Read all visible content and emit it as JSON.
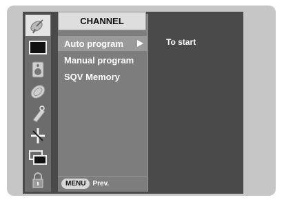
{
  "menu": {
    "title": "CHANNEL",
    "items": [
      {
        "label": "Auto program",
        "selected": true
      },
      {
        "label": "Manual program",
        "selected": false
      },
      {
        "label": "SQV Memory",
        "selected": false
      }
    ]
  },
  "submenu": {
    "text": "To start"
  },
  "footer": {
    "key_label": "MENU",
    "action_label": "Prev."
  },
  "icons": [
    {
      "name": "satellite-dish-icon",
      "active": true
    },
    {
      "name": "picture-icon",
      "active": false
    },
    {
      "name": "speaker-icon",
      "active": false
    },
    {
      "name": "clock-icon",
      "active": false
    },
    {
      "name": "tag-icon",
      "active": false
    },
    {
      "name": "setup-cross-icon",
      "active": false
    },
    {
      "name": "screen-icon",
      "active": false
    },
    {
      "name": "lock-icon",
      "active": false
    }
  ],
  "colors": {
    "panel": "#4a4a4a",
    "menu_column": "#7d7d7d",
    "selected_row": "#9a9a9a",
    "active_icon_bg": "#e4e4e4"
  }
}
